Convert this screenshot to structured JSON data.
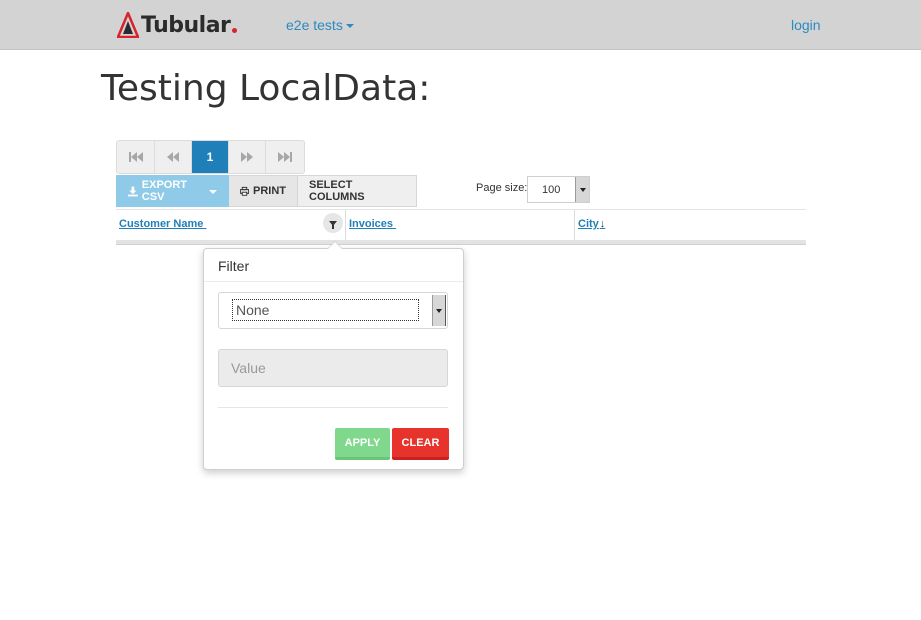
{
  "navbar": {
    "brand": "Tubular",
    "dropdown_label": "e2e tests",
    "login_label": "login"
  },
  "page": {
    "title": "Testing LocalData:"
  },
  "pager": {
    "current_page": "1"
  },
  "toolbar": {
    "export_label": "EXPORT CSV",
    "print_label": "PRINT",
    "columns_label": "SELECT COLUMNS"
  },
  "page_size": {
    "label": "Page size:",
    "value": "100"
  },
  "grid": {
    "columns": [
      {
        "label": "Customer Name",
        "sort": ""
      },
      {
        "label": "Invoices",
        "sort": ""
      },
      {
        "label": "City",
        "sort": "↓"
      }
    ]
  },
  "filter_popover": {
    "title": "Filter",
    "operator_value": "None",
    "value_placeholder": "Value",
    "apply_label": "APPLY",
    "clear_label": "CLEAR"
  },
  "colors": {
    "navbar_bg": "#d3d3d3",
    "link": "#2a8bc1",
    "primary": "#1f7fb8",
    "export_bg": "#8fcbe8",
    "apply_bg": "#7fd88c",
    "clear_bg": "#e8332d",
    "brand_accent": "#d9232a"
  },
  "icons": {
    "brand_logo": "tubular-logo-icon",
    "first_page": "fast-backward-icon",
    "prev_page": "backward-icon",
    "next_page": "forward-icon",
    "last_page": "fast-forward-icon",
    "export": "download-icon",
    "print": "print-icon",
    "filter": "filter-icon"
  }
}
